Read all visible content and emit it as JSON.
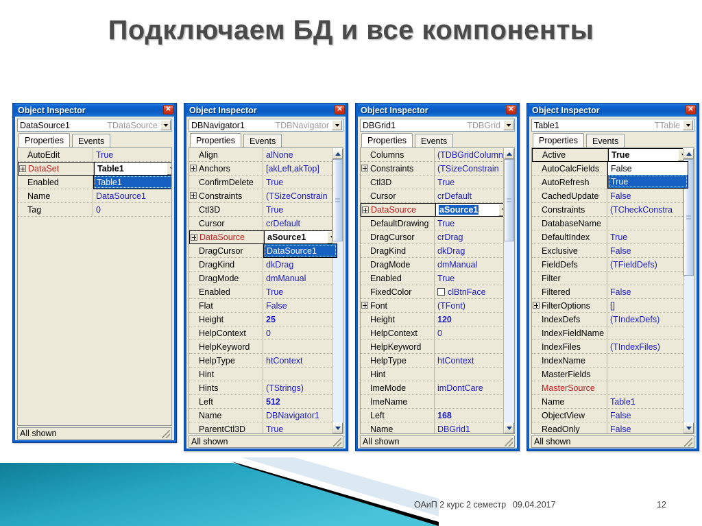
{
  "slide": {
    "title": "Подключаем БД и все компоненты",
    "footer": {
      "course": "ОАиП 2 курс 2 семестр",
      "date": "09.04.2017",
      "page": "12"
    }
  },
  "common": {
    "window_title": "Object Inspector",
    "close_glyph": "✕",
    "tab_properties": "Properties",
    "tab_events": "Events",
    "status": "All shown"
  },
  "panels": [
    {
      "id": "datasource1",
      "object_name": "DataSource1",
      "object_class": "TDataSource",
      "rows": [
        {
          "name": "AutoEdit",
          "value": "True",
          "expand": false
        },
        {
          "name": "DataSet",
          "value": "Table1",
          "expand": true,
          "red": true,
          "editing": true,
          "bold": true
        },
        {
          "name": "Enabled",
          "value": "",
          "expand": false
        },
        {
          "name": "Name",
          "value": "DataSource1",
          "expand": false
        },
        {
          "name": "Tag",
          "value": "0",
          "expand": false
        }
      ],
      "dropdown": {
        "options": [
          "Table1"
        ],
        "selected": "Table1"
      },
      "scrollbar": false
    },
    {
      "id": "dbnavigator1",
      "object_name": "DBNavigator1",
      "object_class": "TDBNavigator",
      "rows": [
        {
          "name": "Align",
          "value": "alNone",
          "expand": false
        },
        {
          "name": "Anchors",
          "value": "[akLeft,akTop]",
          "expand": true
        },
        {
          "name": "ConfirmDelete",
          "value": "True",
          "expand": false
        },
        {
          "name": "Constraints",
          "value": "(TSizeConstrain",
          "expand": true
        },
        {
          "name": "Ctl3D",
          "value": "True",
          "expand": false
        },
        {
          "name": "Cursor",
          "value": "crDefault",
          "expand": false
        },
        {
          "name": "DataSource",
          "value": "aSource1",
          "expand": true,
          "red": true,
          "editing": true,
          "bold": true
        },
        {
          "name": "DragCursor",
          "value": "",
          "expand": false
        },
        {
          "name": "DragKind",
          "value": "dkDrag",
          "expand": false
        },
        {
          "name": "DragMode",
          "value": "dmManual",
          "expand": false
        },
        {
          "name": "Enabled",
          "value": "True",
          "expand": false
        },
        {
          "name": "Flat",
          "value": "False",
          "expand": false
        },
        {
          "name": "Height",
          "value": "25",
          "expand": false,
          "bold": true
        },
        {
          "name": "HelpContext",
          "value": "0",
          "expand": false
        },
        {
          "name": "HelpKeyword",
          "value": "",
          "expand": false
        },
        {
          "name": "HelpType",
          "value": "htContext",
          "expand": false
        },
        {
          "name": "Hint",
          "value": "",
          "expand": false
        },
        {
          "name": "Hints",
          "value": "(TStrings)",
          "expand": false
        },
        {
          "name": "Left",
          "value": "512",
          "expand": false,
          "bold": true
        },
        {
          "name": "Name",
          "value": "DBNavigator1",
          "expand": false
        },
        {
          "name": "ParentCtl3D",
          "value": "True",
          "expand": false
        }
      ],
      "dropdown": {
        "options": [
          "DataSource1"
        ],
        "selected": "DataSource1"
      },
      "scrollbar": true
    },
    {
      "id": "dbgrid1",
      "object_name": "DBGrid1",
      "object_class": "TDBGrid",
      "rows": [
        {
          "name": "Columns",
          "value": "(TDBGridColumn",
          "expand": false
        },
        {
          "name": "Constraints",
          "value": "(TSizeConstrain",
          "expand": true
        },
        {
          "name": "Ctl3D",
          "value": "True",
          "expand": false
        },
        {
          "name": "Cursor",
          "value": "crDefault",
          "expand": false
        },
        {
          "name": "DataSource",
          "value": "aSource1",
          "expand": true,
          "red": true,
          "editing": true,
          "selected": true,
          "bold": true
        },
        {
          "name": "DefaultDrawing",
          "value": "True",
          "expand": false
        },
        {
          "name": "DragCursor",
          "value": "crDrag",
          "expand": false
        },
        {
          "name": "DragKind",
          "value": "dkDrag",
          "expand": false
        },
        {
          "name": "DragMode",
          "value": "dmManual",
          "expand": false
        },
        {
          "name": "Enabled",
          "value": "True",
          "expand": false
        },
        {
          "name": "FixedColor",
          "value": "clBtnFace",
          "expand": false,
          "swatch": true
        },
        {
          "name": "Font",
          "value": "(TFont)",
          "expand": true
        },
        {
          "name": "Height",
          "value": "120",
          "expand": false,
          "bold": true
        },
        {
          "name": "HelpContext",
          "value": "0",
          "expand": false
        },
        {
          "name": "HelpKeyword",
          "value": "",
          "expand": false
        },
        {
          "name": "HelpType",
          "value": "htContext",
          "expand": false
        },
        {
          "name": "Hint",
          "value": "",
          "expand": false
        },
        {
          "name": "ImeMode",
          "value": "imDontCare",
          "expand": false
        },
        {
          "name": "ImeName",
          "value": "",
          "expand": false
        },
        {
          "name": "Left",
          "value": "168",
          "expand": false,
          "bold": true
        },
        {
          "name": "Name",
          "value": "DBGrid1",
          "expand": false
        }
      ],
      "dropdown": null,
      "scrollbar": true
    },
    {
      "id": "table1",
      "object_name": "Table1",
      "object_class": "TTable",
      "rows": [
        {
          "name": "Active",
          "value": "True",
          "expand": false,
          "editing": true,
          "bold": true
        },
        {
          "name": "AutoCalcFields",
          "value": "",
          "expand": false
        },
        {
          "name": "AutoRefresh",
          "value": "",
          "expand": false
        },
        {
          "name": "CachedUpdate",
          "value": "False",
          "expand": false
        },
        {
          "name": "Constraints",
          "value": "(TCheckConstra",
          "expand": false
        },
        {
          "name": "DatabaseName",
          "value": "",
          "expand": false
        },
        {
          "name": "DefaultIndex",
          "value": "True",
          "expand": false
        },
        {
          "name": "Exclusive",
          "value": "False",
          "expand": false
        },
        {
          "name": "FieldDefs",
          "value": "(TFieldDefs)",
          "expand": false
        },
        {
          "name": "Filter",
          "value": "",
          "expand": false
        },
        {
          "name": "Filtered",
          "value": "False",
          "expand": false
        },
        {
          "name": "FilterOptions",
          "value": "[]",
          "expand": true
        },
        {
          "name": "IndexDefs",
          "value": "(TIndexDefs)",
          "expand": false
        },
        {
          "name": "IndexFieldName",
          "value": "",
          "expand": false
        },
        {
          "name": "IndexFiles",
          "value": "(TIndexFiles)",
          "expand": false
        },
        {
          "name": "IndexName",
          "value": "",
          "expand": false
        },
        {
          "name": "MasterFields",
          "value": "",
          "expand": false
        },
        {
          "name": "MasterSource",
          "value": "",
          "expand": false,
          "red": true
        },
        {
          "name": "Name",
          "value": "Table1",
          "expand": false
        },
        {
          "name": "ObjectView",
          "value": "False",
          "expand": false
        },
        {
          "name": "ReadOnly",
          "value": "False",
          "expand": false
        }
      ],
      "dropdown": {
        "options": [
          "False",
          "True"
        ],
        "selected": "True"
      },
      "scrollbar": true
    }
  ],
  "colors": {
    "title_bar_blue": "#0a5fc8",
    "window_face": "#ece9d8",
    "value_text": "#1b1bc0",
    "required_prop": "#c02020",
    "selection_blue": "#1560c0",
    "decor_teal": "#1f9cb8"
  }
}
